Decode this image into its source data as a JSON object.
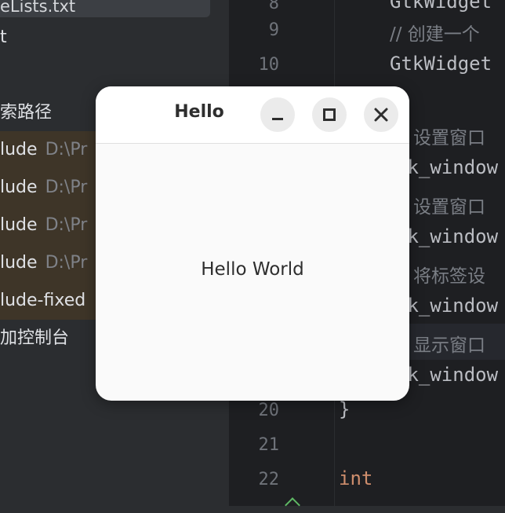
{
  "project_panel": {
    "file_name": "eLists.txt",
    "tree_items": [
      {
        "label": "t",
        "path": ""
      },
      {
        "label": "索路径",
        "path": ""
      },
      {
        "label": "lude",
        "path": "D:\\Pr"
      },
      {
        "label": "lude",
        "path": "D:\\Pr"
      },
      {
        "label": "lude",
        "path": "D:\\Pr"
      },
      {
        "label": "lude",
        "path": "D:\\Pr"
      },
      {
        "label": "lude-fixed",
        "path": ""
      },
      {
        "label": "加控制台",
        "path": ""
      }
    ]
  },
  "gutter": {
    "line_numbers": [
      "8",
      "9",
      "10",
      "20",
      "21",
      "22"
    ]
  },
  "editor": {
    "lines": [
      {
        "text": "GtkWidget",
        "kind": "code"
      },
      {
        "text": "// 创建一个",
        "kind": "comment"
      },
      {
        "text": "GtkWidget",
        "kind": "code"
      },
      {
        "text": "/ 设置窗口",
        "kind": "comment"
      },
      {
        "text": "tk_window",
        "kind": "code"
      },
      {
        "text": "/ 设置窗口",
        "kind": "comment"
      },
      {
        "text": "tk_window",
        "kind": "code"
      },
      {
        "text": "/ 将标签设",
        "kind": "comment"
      },
      {
        "text": "tk_window",
        "kind": "code"
      },
      {
        "text": "/ 显示窗口",
        "kind": "comment"
      },
      {
        "text": "tk_window",
        "kind": "code"
      },
      {
        "text": "}",
        "kind": "code"
      },
      {
        "text": "int",
        "kind": "keyword"
      }
    ]
  },
  "window": {
    "title": "Hello",
    "label": "Hello World",
    "buttons": {
      "minimize_icon": "minimize-icon",
      "maximize_icon": "maximize-icon",
      "close_icon": "close-icon"
    }
  },
  "colors": {
    "editor_bg": "#1e1f22",
    "panel_bg": "#2b2d30",
    "highlight_row": "#3e3528",
    "keyword": "#cf8e6d",
    "comment": "#7a7e85",
    "window_bg": "#fafafa"
  }
}
